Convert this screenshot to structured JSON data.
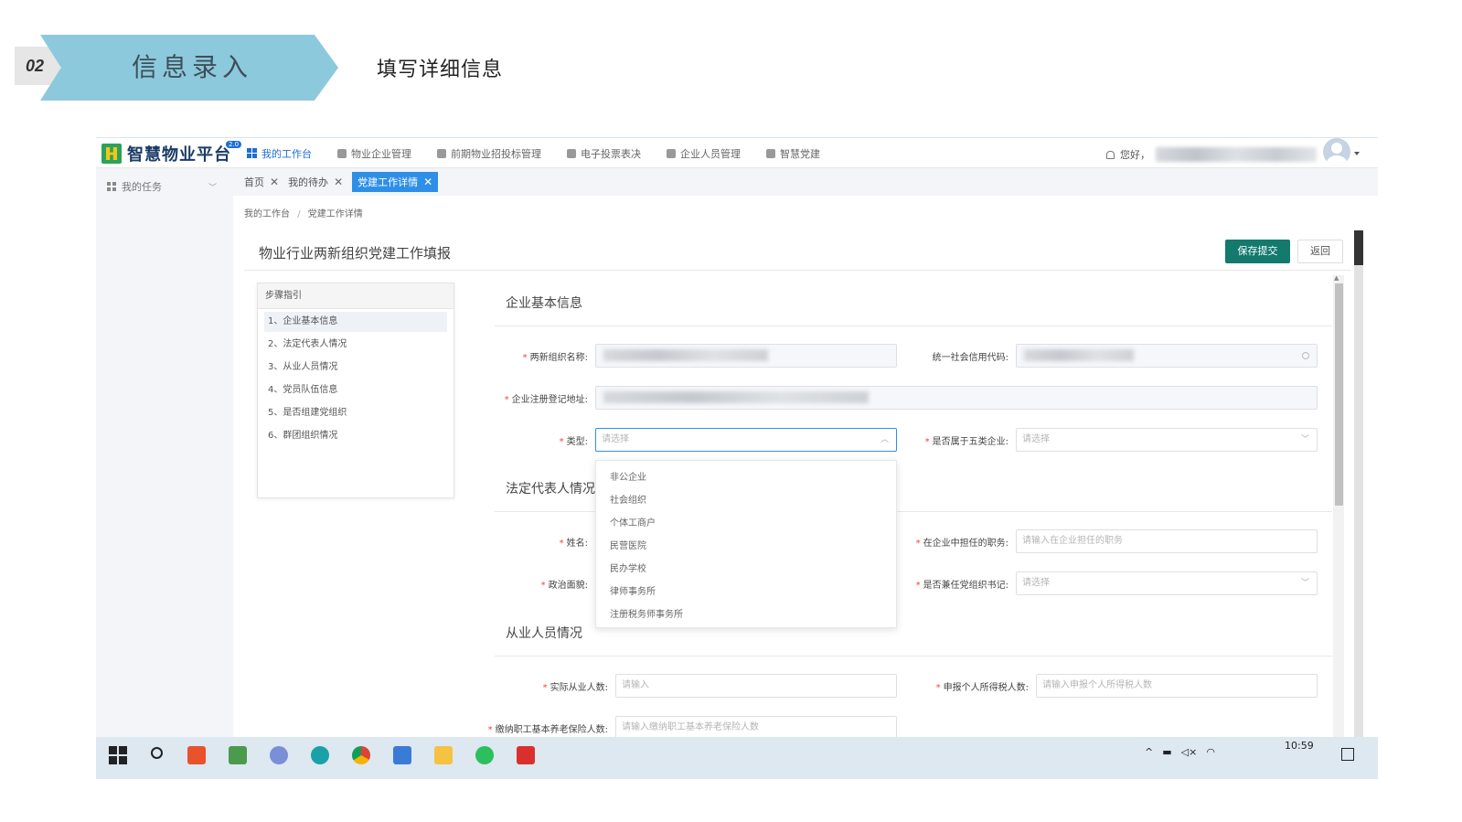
{
  "slide": {
    "step_number": "02",
    "title": "信息录入",
    "subtitle": "填写详细信息"
  },
  "app": {
    "logo_text": "智慧物业平台",
    "logo_badge": "2.0",
    "nav": [
      {
        "label": "我的工作台",
        "icon": "grid-icon"
      },
      {
        "label": "物业企业管理",
        "icon": "building-icon"
      },
      {
        "label": "前期物业招投标管理",
        "icon": "folder-icon"
      },
      {
        "label": "电子投票表决",
        "icon": "vote-icon"
      },
      {
        "label": "企业人员管理",
        "icon": "home-icon"
      },
      {
        "label": "智慧党建",
        "icon": "document-icon"
      }
    ],
    "greeting": "您好，",
    "sidebar": {
      "item": "我的任务"
    },
    "tabs": [
      {
        "label": "首页"
      },
      {
        "label": "我的待办"
      },
      {
        "label": "党建工作详情"
      }
    ],
    "breadcrumb": {
      "root": "我的工作台",
      "sep": "/",
      "current": "党建工作详情"
    },
    "page_title": "物业行业两新组织党建工作填报",
    "buttons": {
      "save": "保存提交",
      "back": "返回"
    },
    "steps": {
      "header": "步骤指引",
      "items": [
        "1、企业基本信息",
        "2、法定代表人情况",
        "3、从业人员情况",
        "4、党员队伍信息",
        "5、是否组建党组织",
        "6、群团组织情况"
      ]
    },
    "sections": {
      "basic": "企业基本信息",
      "legal": "法定代表人情况",
      "staff": "从业人员情况"
    },
    "form": {
      "org_name_label": "两新组织名称:",
      "credit_code_label": "统一社会信用代码:",
      "address_label": "企业注册登记地址:",
      "type_label": "类型:",
      "type_placeholder": "请选择",
      "five_class_label": "是否属于五类企业:",
      "five_class_placeholder": "请选择",
      "name_label": "姓名:",
      "position_label": "在企业中担任的职务:",
      "position_placeholder": "请输入在企业担任的职务",
      "political_label": "政治面貌:",
      "secretary_label": "是否兼任党组织书记:",
      "secretary_placeholder": "请选择",
      "actual_staff_label": "实际从业人数:",
      "actual_staff_placeholder": "请输入",
      "tax_label": "申报个人所得税人数:",
      "tax_placeholder": "请输入申报个人所得税人数",
      "pension_label": "缴纳职工基本养老保险人数:",
      "pension_placeholder": "请输入缴纳职工基本养老保险人数"
    },
    "type_options": [
      "非公企业",
      "社会组织",
      "个体工商户",
      "民营医院",
      "民办学校",
      "律师事务所",
      "注册税务师事务所"
    ],
    "taskbar": {
      "tray": "^",
      "clock": "10:59"
    }
  },
  "colors": {
    "banner": "#8dc9dc",
    "primary": "#2f8fe6",
    "save_button": "#137a6d",
    "required": "#e44444"
  }
}
